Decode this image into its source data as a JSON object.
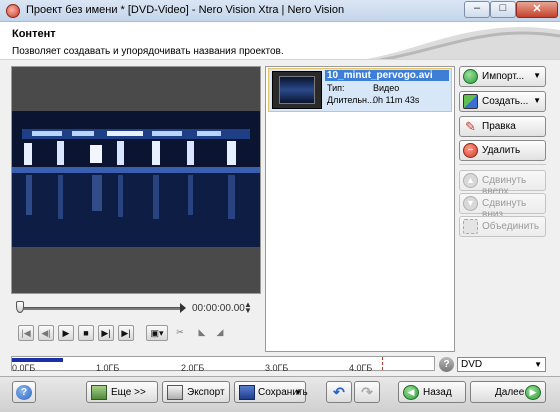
{
  "window": {
    "title": "Проект без имени * [DVD-Video] - Nero Vision Xtra | Nero Vision",
    "min_glyph": "–",
    "max_glyph": "□",
    "close_glyph": "✕"
  },
  "header": {
    "title": "Контент",
    "subtitle": "Позволяет создавать и упорядочивать названия проектов."
  },
  "player": {
    "time": "00:00:00.00",
    "controls": [
      {
        "name": "go-start-icon",
        "glyph": "|◀",
        "enabled": false
      },
      {
        "name": "prev-frame-icon",
        "glyph": "◀|",
        "enabled": false
      },
      {
        "name": "play-icon",
        "glyph": "▶",
        "enabled": true
      },
      {
        "name": "stop-icon",
        "glyph": "■",
        "enabled": true
      },
      {
        "name": "next-frame-icon",
        "glyph": "▶|",
        "enabled": true
      },
      {
        "name": "go-end-icon",
        "glyph": "▶|",
        "enabled": true
      }
    ],
    "snapshot_glyph": "▣▾",
    "cut_glyph": "✂",
    "mark_in_glyph": "◣",
    "mark_out_glyph": "◢"
  },
  "project_list": {
    "items": [
      {
        "name": "10_minut_pervogo.avi",
        "type_label": "Тип:",
        "type_value": "Видео",
        "duration_label": "Длительн...",
        "duration_value": "0h 11m 43s"
      }
    ]
  },
  "actions": {
    "import": "Импорт...",
    "create": "Создать...",
    "edit": "Правка",
    "delete": "Удалить",
    "move_up": "Сдвинуть вверх",
    "move_down": "Сдвинуть вниз",
    "merge": "Объединить"
  },
  "capacity": {
    "ticks": [
      "0.0ГБ",
      "1.0ГБ",
      "2.0ГБ",
      "3.0ГБ",
      "4.0ГБ"
    ],
    "used_fraction": 0.14,
    "disc_type": "DVD"
  },
  "bottom": {
    "help": "?",
    "more": "Еще >>",
    "export": "Экспорт",
    "save": "Сохранить",
    "back": "Назад",
    "next": "Далее"
  },
  "colors": {
    "selection": "#3d7fd6",
    "capacity_fill": "#1a30a8",
    "accent_green": "#2e9a3a",
    "accent_red": "#d03a2a"
  }
}
